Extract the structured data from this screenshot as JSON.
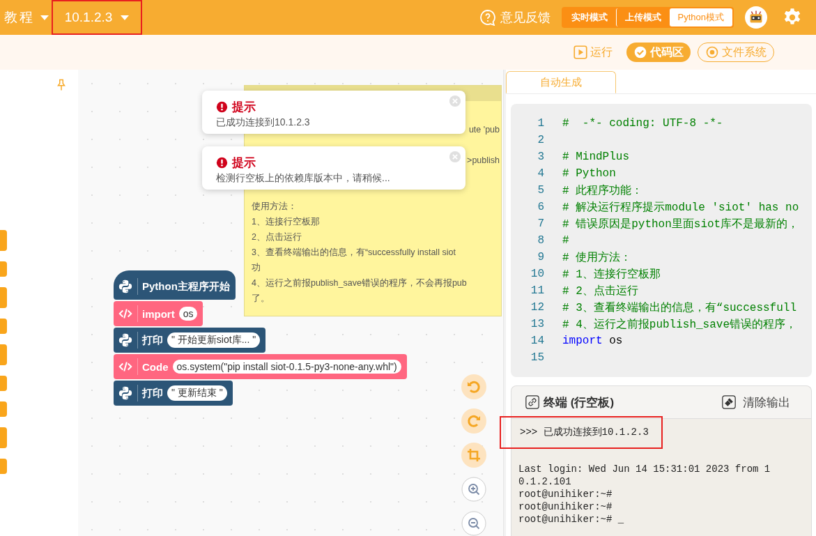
{
  "top_bar": {
    "menu": {
      "label": "教程"
    },
    "device": {
      "label": "10.1.2.3",
      "highlighted": true
    },
    "feedback": {
      "label": "意见反馈"
    },
    "modes": [
      {
        "label": "实时模式",
        "selected": false
      },
      {
        "label": "上传模式",
        "selected": false
      },
      {
        "label": "Python模式",
        "selected": true
      }
    ]
  },
  "toolbar": [
    {
      "kind": "run",
      "label": "运行",
      "selected": false
    },
    {
      "kind": "code",
      "label": "代码区",
      "selected": true
    },
    {
      "kind": "files",
      "label": "文件系统",
      "selected": false
    }
  ],
  "palette_tabs": [
    {
      "kind": "tall"
    },
    {
      "kind": "short"
    },
    {
      "kind": "tall"
    },
    {
      "kind": "short"
    },
    {
      "kind": "tall"
    },
    {
      "kind": "short"
    },
    {
      "kind": "short"
    },
    {
      "kind": "tall"
    },
    {
      "kind": "short"
    }
  ],
  "canvas": {
    "note": {
      "partial_lines": [
        {
          "kind": "tail",
          "text": "ute 'pub"
        },
        {
          "kind": "tail",
          "text": ">publish"
        }
      ],
      "lines": [
        "使用方法：",
        "1、连接行空板那",
        "2、点击运行",
        "3、查看终端输出的信息，有“successfully install siot",
        "功",
        "4、运行之前报publish_save错误的程序，不会再报pub",
        "了。"
      ]
    },
    "blocks": [
      {
        "kind": "hat",
        "label": "Python主程序开始"
      },
      {
        "kind": "code",
        "label": "import",
        "input": "os"
      },
      {
        "kind": "python",
        "label": "打印",
        "input": "\" 开始更新siot库... \""
      },
      {
        "kind": "code",
        "label": "Code",
        "input": "os.system(\"pip install siot-0.1.5-py3-none-any.whl\")"
      },
      {
        "kind": "python",
        "label": "打印",
        "input": "\" 更新结束 \""
      }
    ],
    "toasts": [
      {
        "title": "提示",
        "message": "已成功连接到10.1.2.3"
      },
      {
        "title": "提示",
        "message": "检测行空板上的依赖库版本中，请稍候..."
      }
    ]
  },
  "code_panel": {
    "tabs": [
      {
        "label": "自动生成",
        "selected": true
      }
    ],
    "lines": [
      {
        "num": "1",
        "kind": "comment",
        "text": "#  -*- coding: UTF-8 -*-"
      },
      {
        "num": "2",
        "kind": "blank"
      },
      {
        "num": "3",
        "kind": "comment",
        "text": "# MindPlus"
      },
      {
        "num": "4",
        "kind": "comment",
        "text": "# Python"
      },
      {
        "num": "5",
        "kind": "comment",
        "text": "# 此程序功能："
      },
      {
        "num": "6",
        "kind": "comment",
        "text": "# 解决运行程序提示module 'siot' has no"
      },
      {
        "num": "7",
        "kind": "comment",
        "text": "# 错误原因是python里面siot库不是最新的，"
      },
      {
        "num": "8",
        "kind": "comment",
        "text": "#"
      },
      {
        "num": "9",
        "kind": "comment",
        "text": "# 使用方法："
      },
      {
        "num": "10",
        "kind": "comment",
        "text": "# 1、连接行空板那"
      },
      {
        "num": "11",
        "kind": "comment",
        "text": "# 2、点击运行"
      },
      {
        "num": "12",
        "kind": "comment",
        "text": "# 3、查看终端输出的信息，有“successfull"
      },
      {
        "num": "13",
        "kind": "comment",
        "text": "# 4、运行之前报publish_save错误的程序，"
      },
      {
        "num": "14",
        "kind": "code",
        "keyword": "import",
        "text": "os"
      },
      {
        "num": "15",
        "kind": "blank"
      }
    ]
  },
  "terminal": {
    "title": "终端 (行空板)",
    "clear_label": "清除输出",
    "lines": [
      {
        "text": ">>> 已成功连接到10.1.2.3",
        "highlighted": true
      },
      {
        "text": "Last login: Wed Jun 14 15:31:01 2023 from 10.1.2.101",
        "highlighted": false
      },
      {
        "text": "root@unihiker:~#",
        "highlighted": false
      },
      {
        "text": "root@unihiker:~#",
        "highlighted": false
      },
      {
        "text": "root@unihiker:~# _",
        "highlighted": false
      }
    ]
  }
}
